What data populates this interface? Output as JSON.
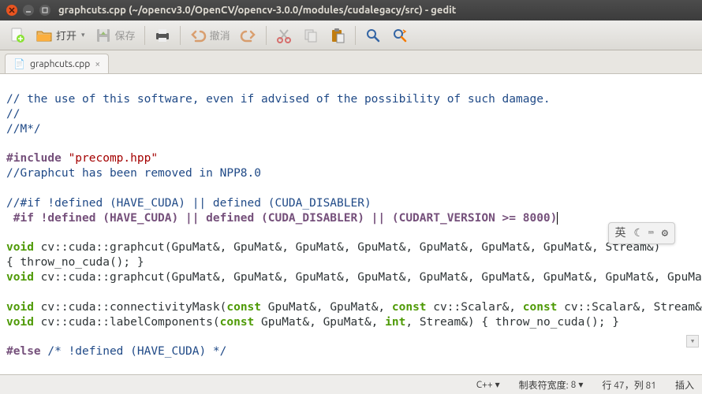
{
  "window": {
    "title": "graphcuts.cpp (~/opencv3.0/OpenCV/opencv-3.0.0/modules/cudalegacy/src) - gedit"
  },
  "toolbar": {
    "open_label": "打开",
    "save_label": "保存",
    "undo_label": "撤消"
  },
  "tab": {
    "icon": "📄",
    "filename": "graphcuts.cpp",
    "close": "×"
  },
  "code": {
    "l1": "// the use of this software, even if advised of the possibility of such damage.",
    "l2": "//",
    "l3": "//M*/",
    "l4": "",
    "l5_a": "#include",
    "l5_b": " \"precomp.hpp\"",
    "l6": "//Graphcut has been removed in NPP8.0",
    "l7": "",
    "l8": "//#if !defined (HAVE_CUDA) || defined (CUDA_DISABLER)",
    "l9": " #if !defined (HAVE_CUDA) || defined (CUDA_DISABLER) || (CUDART_VERSION >= 8000)",
    "l10": "",
    "l11_a": "void",
    "l11_b": " cv::cuda::graphcut(GpuMat&, GpuMat&, GpuMat&, GpuMat&, GpuMat&, GpuMat&, GpuMat&, Stream&)",
    "l12": "{ throw_no_cuda(); }",
    "l13_a": "void",
    "l13_b": " cv::cuda::graphcut(GpuMat&, GpuMat&, GpuMat&, GpuMat&, GpuMat&, GpuMat&, GpuMat&, GpuMat&, GpuMat&, GpuMat&, GpuMat&, Stream&) { throw_no_cuda(); }",
    "l14": "",
    "l15_a": "void",
    "l15_b": " cv::cuda::connectivityMask(",
    "l15_c": "const",
    "l15_d": " GpuMat&, GpuMat&, ",
    "l15_e": "const",
    "l15_f": " cv::Scalar&, ",
    "l15_g": "const",
    "l15_h": " cv::Scalar&, Stream&) { throw_no_cuda(); }",
    "l16_a": "void",
    "l16_b": " cv::cuda::labelComponents(",
    "l16_c": "const",
    "l16_d": " GpuMat&, GpuMat&, ",
    "l16_e": "int",
    "l16_f": ", Stream&) { throw_no_cuda(); }",
    "l17": "",
    "l18_a": "#else",
    "l18_b": " /* !defined (HAVE_CUDA) */"
  },
  "ime": {
    "lang": "英"
  },
  "status": {
    "lang": "C++",
    "lang_arrow": "▾",
    "tabwidth_label": "制表符宽度:",
    "tabwidth_value": "8",
    "tabwidth_arrow": "▾",
    "position": "行 47，列 81",
    "mode": "插入"
  }
}
